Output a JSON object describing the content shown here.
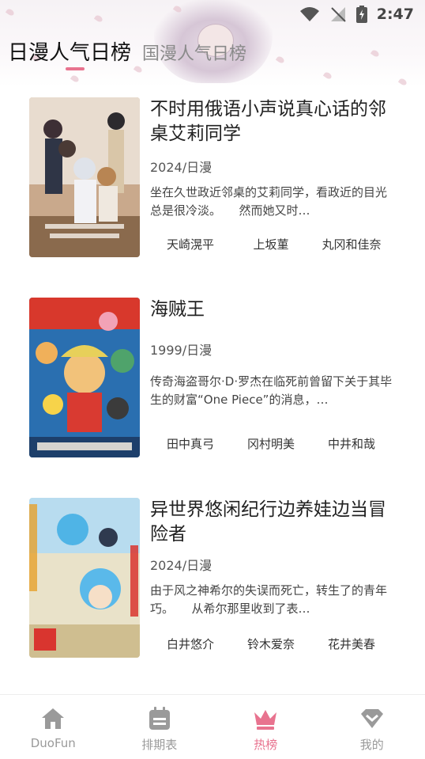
{
  "status": {
    "time": "2:47"
  },
  "tabs": [
    {
      "label": "日漫人气日榜",
      "active": true
    },
    {
      "label": "国漫人气日榜",
      "active": false
    }
  ],
  "items": [
    {
      "title": "不时用俄语小声说真心话的邻桌艾莉同学",
      "meta": "2024/日漫",
      "desc": "坐在久世政近邻桌的艾莉同学，看政近的目光总是很冷淡。　　然而她又时…",
      "cast": [
        "天崎滉平",
        "上坂菫",
        "丸冈和佳奈"
      ]
    },
    {
      "title": "海贼王",
      "meta": "1999/日漫",
      "desc": "传奇海盗哥尔·D·罗杰在临死前曾留下关于其毕生的财富“One Piece”的消息，…",
      "cast": [
        "田中真弓",
        "冈村明美",
        "中井和哉"
      ]
    },
    {
      "title": "异世界悠闲纪行边养娃边当冒险者",
      "meta": "2024/日漫",
      "desc": "由于风之神希尔的失误而死亡，转生了的青年巧。　　从希尔那里收到了表…",
      "cast": [
        "白井悠介",
        "铃木爱奈",
        "花井美春"
      ]
    }
  ],
  "nav": [
    {
      "label": "DuoFun",
      "icon": "home-icon",
      "active": false
    },
    {
      "label": "排期表",
      "icon": "schedule-icon",
      "active": false
    },
    {
      "label": "热榜",
      "icon": "crown-icon",
      "active": true
    },
    {
      "label": "我的",
      "icon": "profile-icon",
      "active": false
    }
  ],
  "colors": {
    "accent": "#e8738f",
    "inactive": "#9a9a9a"
  }
}
